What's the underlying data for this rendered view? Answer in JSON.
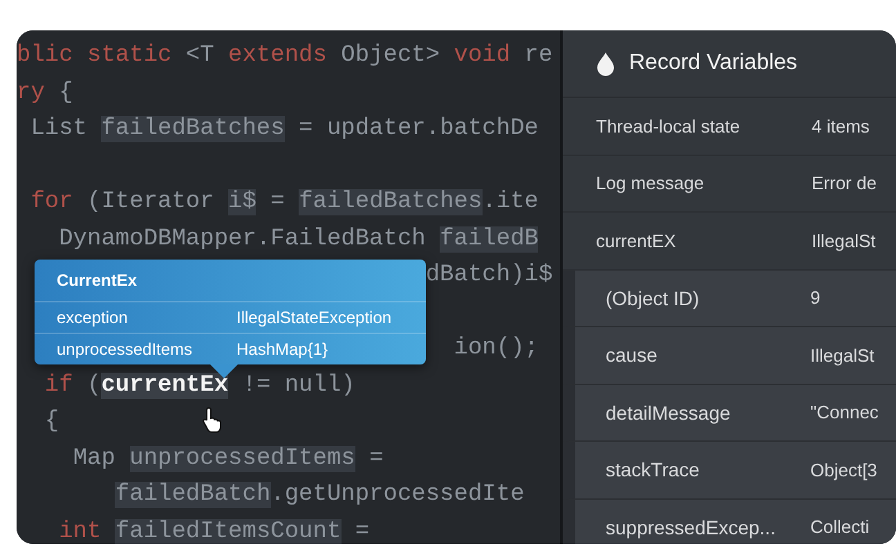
{
  "code": {
    "lines": [
      {
        "kind": "code",
        "tokens": [
          {
            "text": "blic static ",
            "kind": "keyword"
          },
          {
            "text": "<T ",
            "kind": "plain"
          },
          {
            "text": "extends",
            "kind": "keyword"
          },
          {
            "text": " Object> ",
            "kind": "plain"
          },
          {
            "text": "void",
            "kind": "keyword"
          },
          {
            "text": " re",
            "kind": "plain"
          }
        ]
      },
      {
        "kind": "code",
        "tokens": [
          {
            "text": "ry",
            "kind": "keyword"
          },
          {
            "text": " {",
            "kind": "plain"
          }
        ]
      },
      {
        "kind": "code",
        "tokens": [
          {
            "text": " List ",
            "kind": "plain"
          },
          {
            "text": "failedBatches",
            "kind": "var"
          },
          {
            "text": " = updater.batchDe",
            "kind": "plain"
          }
        ]
      },
      {
        "kind": "blank"
      },
      {
        "kind": "code",
        "tokens": [
          {
            "text": " for",
            "kind": "keyword"
          },
          {
            "text": " (Iterator ",
            "kind": "plain"
          },
          {
            "text": "i$",
            "kind": "var"
          },
          {
            "text": " = ",
            "kind": "plain"
          },
          {
            "text": "failedBatches",
            "kind": "var"
          },
          {
            "text": ".ite",
            "kind": "plain"
          }
        ]
      },
      {
        "kind": "code",
        "tokens": [
          {
            "text": "   DynamoDBMapper.FailedBatch ",
            "kind": "plain"
          },
          {
            "text": "failedB",
            "kind": "var"
          }
        ]
      },
      {
        "kind": "code",
        "tokens": [
          {
            "text": "                             dBatch)i$",
            "kind": "plain"
          }
        ]
      },
      {
        "kind": "blank"
      },
      {
        "kind": "code",
        "tokens": [
          {
            "text": "                               ion();",
            "kind": "plain"
          }
        ]
      },
      {
        "kind": "code",
        "tokens": [
          {
            "text": "  if",
            "kind": "keyword"
          },
          {
            "text": " (",
            "kind": "plain"
          },
          {
            "text": "currentEx",
            "kind": "hover"
          },
          {
            "text": " != null)",
            "kind": "plain"
          }
        ]
      },
      {
        "kind": "code",
        "tokens": [
          {
            "text": "  {",
            "kind": "plain"
          }
        ]
      },
      {
        "kind": "code",
        "tokens": [
          {
            "text": "    Map ",
            "kind": "plain"
          },
          {
            "text": "unprocessedItems",
            "kind": "var"
          },
          {
            "text": " =",
            "kind": "plain"
          }
        ]
      },
      {
        "kind": "code",
        "tokens": [
          {
            "text": "       failedBatch",
            "kind": "var"
          },
          {
            "text": ".getUnprocessedIte",
            "kind": "plain"
          }
        ]
      },
      {
        "kind": "code",
        "tokens": [
          {
            "text": "   int",
            "kind": "keyword"
          },
          {
            "text": " failedItemsCount",
            "kind": "var"
          },
          {
            "text": " =",
            "kind": "plain"
          }
        ]
      }
    ]
  },
  "tooltip": {
    "title": "CurrentEx",
    "rows": [
      {
        "name": "exception",
        "value": "IllegalStateException"
      },
      {
        "name": "unprocessedItems",
        "value": "HashMap{1}"
      }
    ]
  },
  "panel": {
    "title": "Record Variables",
    "rows": [
      {
        "label": "Thread-local state",
        "value": "4 items"
      },
      {
        "label": "Log message",
        "value": "Error de"
      },
      {
        "label": "currentEX",
        "value": "IllegalSt",
        "children": [
          {
            "label": "(Object ID)",
            "value": "9"
          },
          {
            "label": "cause",
            "value": "IllegalSt"
          },
          {
            "label": "detailMessage",
            "value": "\"Connec"
          },
          {
            "label": "stackTrace",
            "value": "Object[3"
          },
          {
            "label": "suppressedExcep...",
            "value": "Collecti"
          }
        ]
      }
    ]
  }
}
